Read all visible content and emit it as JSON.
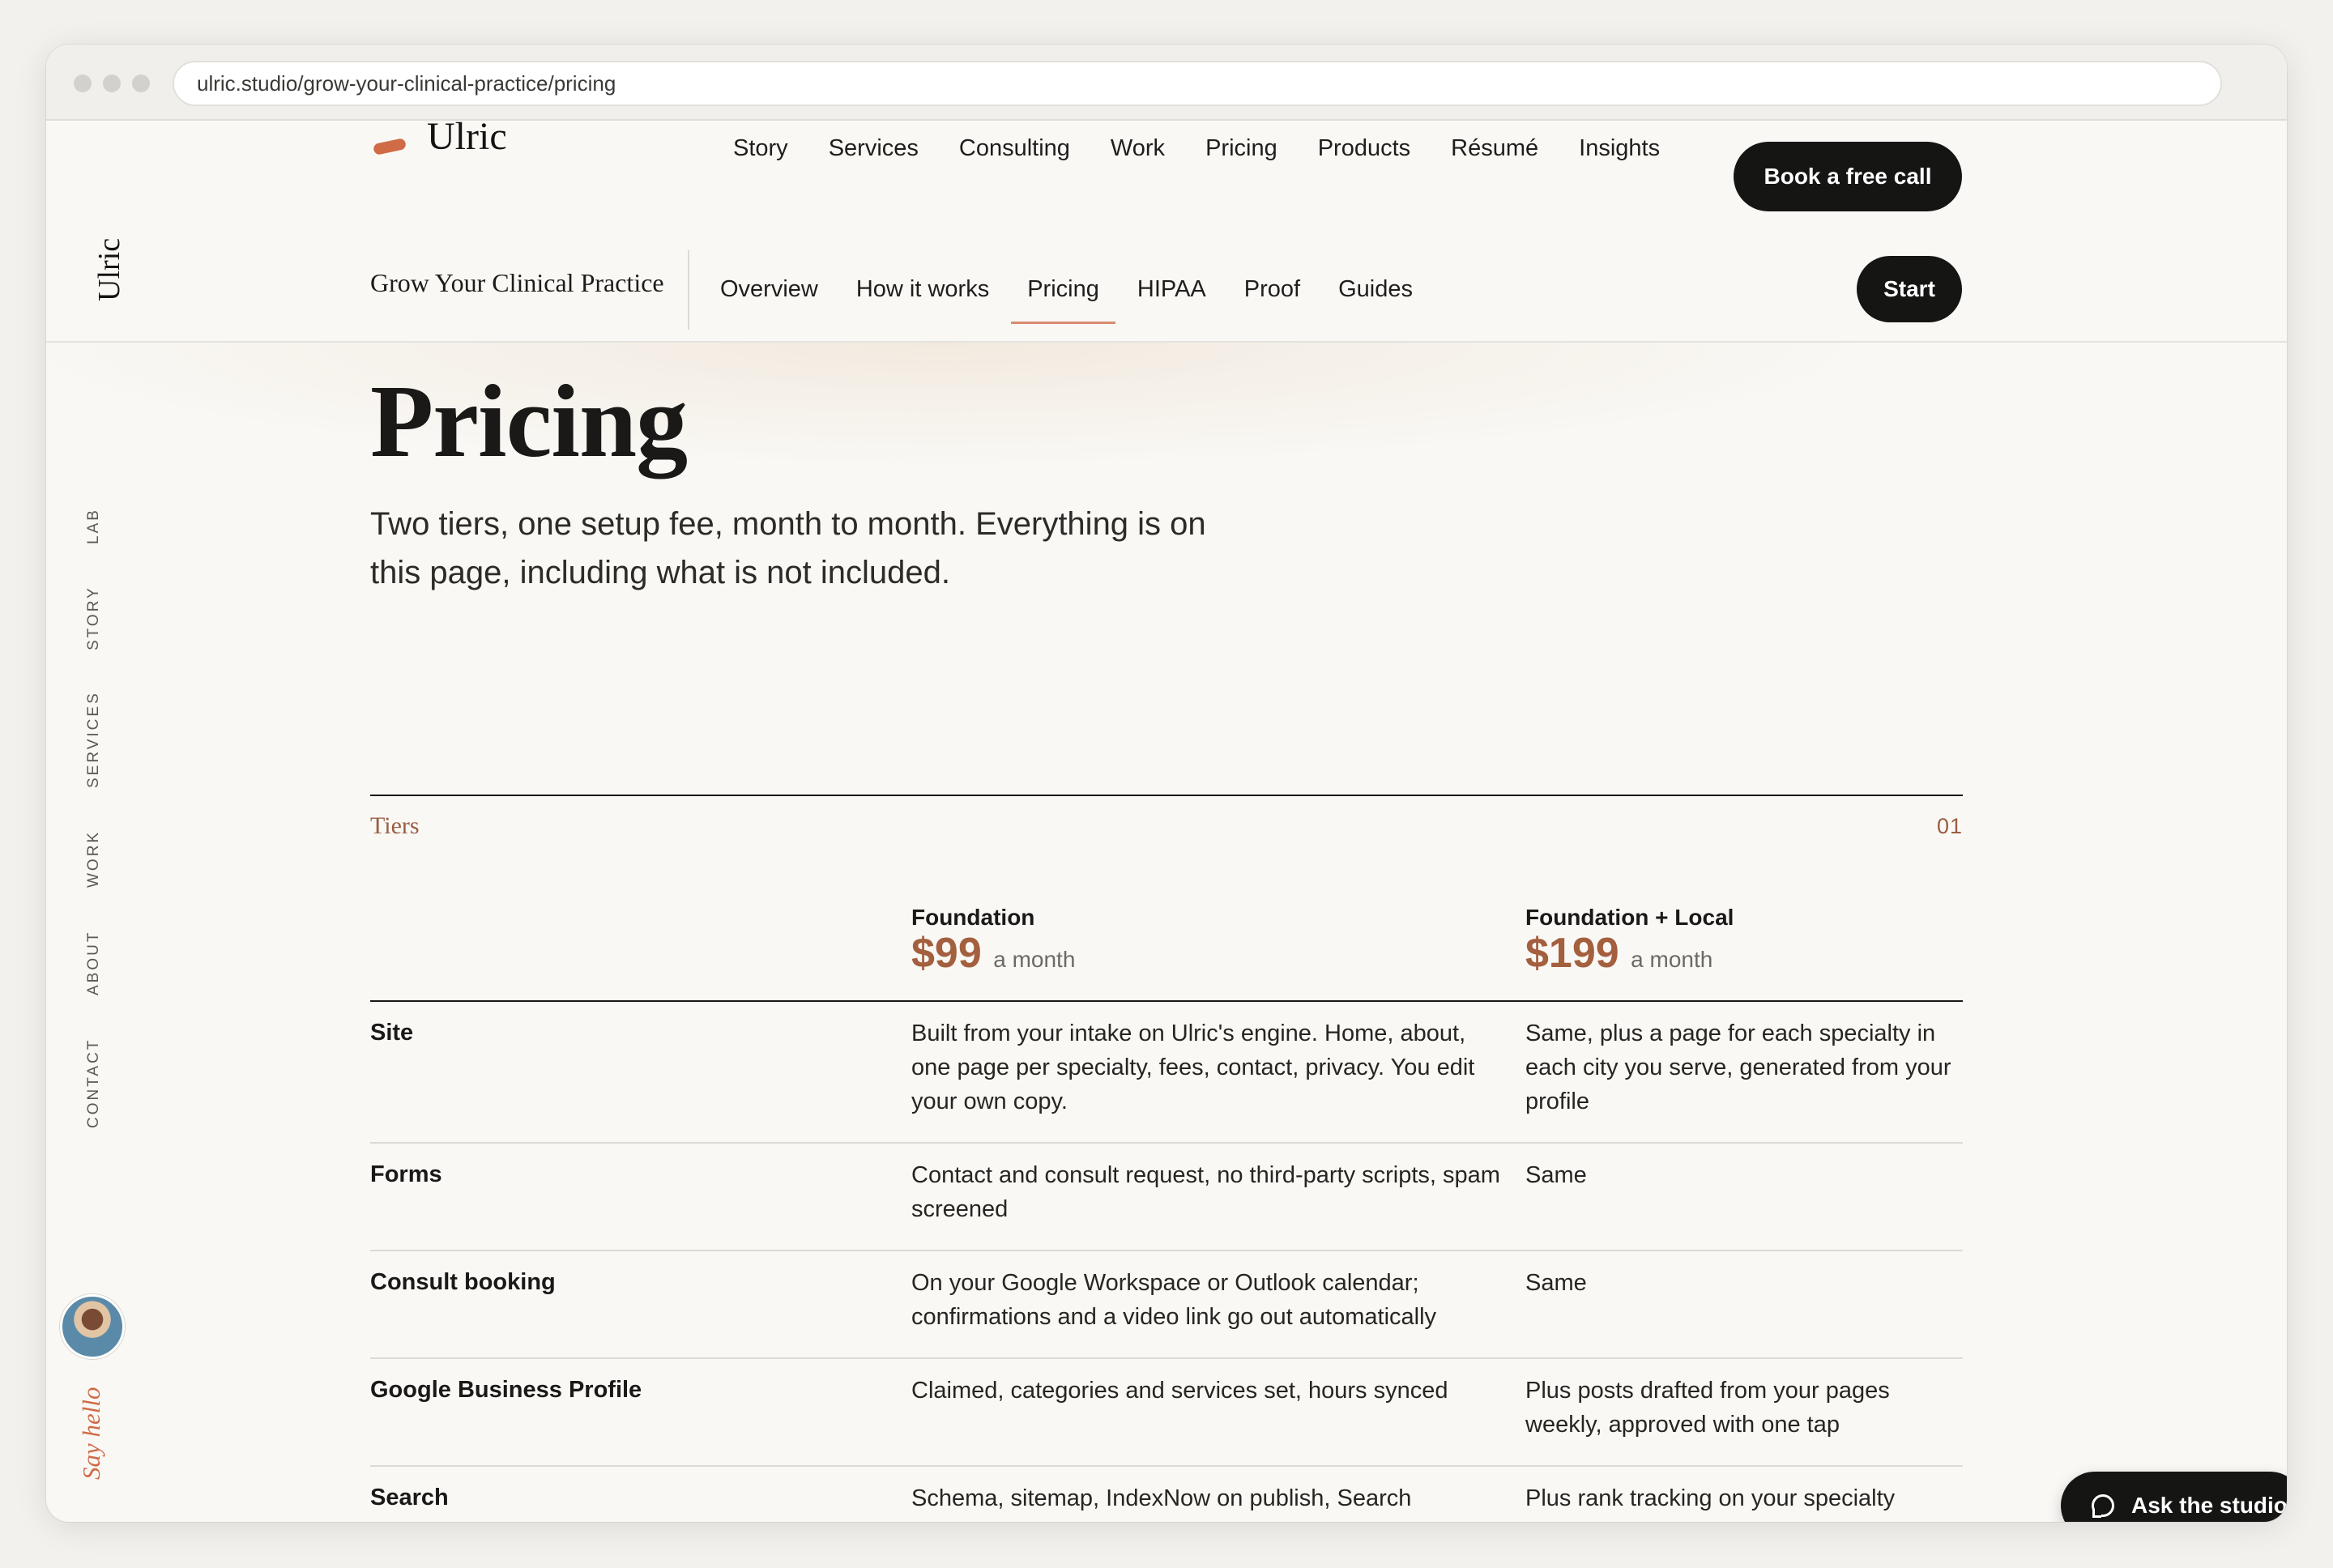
{
  "browser": {
    "url": "ulric.studio/grow-your-clinical-practice/pricing"
  },
  "header": {
    "brand": "Ulric",
    "nav": [
      "Story",
      "Services",
      "Consulting",
      "Work",
      "Pricing",
      "Products",
      "Résumé",
      "Insights"
    ],
    "cta": "Book a free call"
  },
  "subnav": {
    "title": "Grow Your Clinical Practice",
    "tabs": [
      "Overview",
      "How it works",
      "Pricing",
      "HIPAA",
      "Proof",
      "Guides"
    ],
    "active_tab": "Pricing",
    "cta": "Start"
  },
  "sidebar": {
    "brand": "Ulric",
    "links": [
      "LAB",
      "STORY",
      "SERVICES",
      "WORK",
      "ABOUT",
      "CONTACT"
    ],
    "say_hello": "Say hello"
  },
  "hero": {
    "title": "Pricing",
    "lede": "Two tiers, one setup fee, month to month. Everything is on this page, including what is not included."
  },
  "tiers": {
    "label": "Tiers",
    "number": "01",
    "columns": [
      {
        "name": "Foundation",
        "price": "$99",
        "period": "a month"
      },
      {
        "name": "Foundation + Local",
        "price": "$199",
        "period": "a month"
      }
    ],
    "rows": [
      {
        "label": "Site",
        "foundation": "Built from your intake on Ulric's engine. Home, about, one page per specialty, fees, contact, privacy. You edit your own copy.",
        "local": "Same, plus a page for each specialty in each city you serve, generated from your profile"
      },
      {
        "label": "Forms",
        "foundation": "Contact and consult request, no third-party scripts, spam screened",
        "local": "Same"
      },
      {
        "label": "Consult booking",
        "foundation": "On your Google Workspace or Outlook calendar; confirmations and a video link go out automatically",
        "local": "Same"
      },
      {
        "label": "Google Business Profile",
        "foundation": "Claimed, categories and services set, hours synced",
        "local": "Plus posts drafted from your pages weekly, approved with one tap"
      },
      {
        "label": "Search",
        "foundation": "Schema, sitemap, IndexNow on publish, Search",
        "local": "Plus rank tracking on your specialty"
      }
    ]
  },
  "chat": {
    "label": "Ask the studio"
  },
  "colors": {
    "accent": "#cf6b46",
    "price": "#a35f3e",
    "dark": "#151514"
  }
}
